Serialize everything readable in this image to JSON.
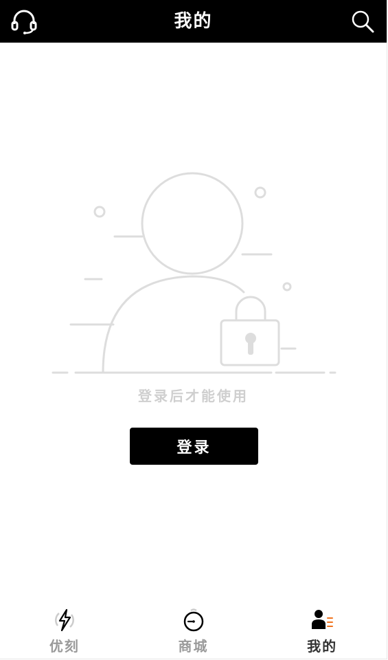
{
  "header": {
    "title": "我的",
    "left_icon": "headset-icon",
    "right_icon": "search-icon"
  },
  "main": {
    "illustration_icon": "locked-user-icon",
    "hint_text": "登录后才能使用",
    "login_label": "登录"
  },
  "tabbar": {
    "items": [
      {
        "label": "优刻",
        "icon": "lightning-icon",
        "active": false
      },
      {
        "label": "商城",
        "icon": "clock-icon",
        "active": false
      },
      {
        "label": "我的",
        "icon": "profile-list-icon",
        "active": true
      }
    ]
  },
  "colors": {
    "header_bg": "#000000",
    "button_bg": "#000000",
    "accent_orange": "#f0721c",
    "illustration_stroke": "#dddddd",
    "hint_text": "#cfcfcf",
    "tab_inactive": "#9a9a9a",
    "tab_active": "#333333"
  }
}
